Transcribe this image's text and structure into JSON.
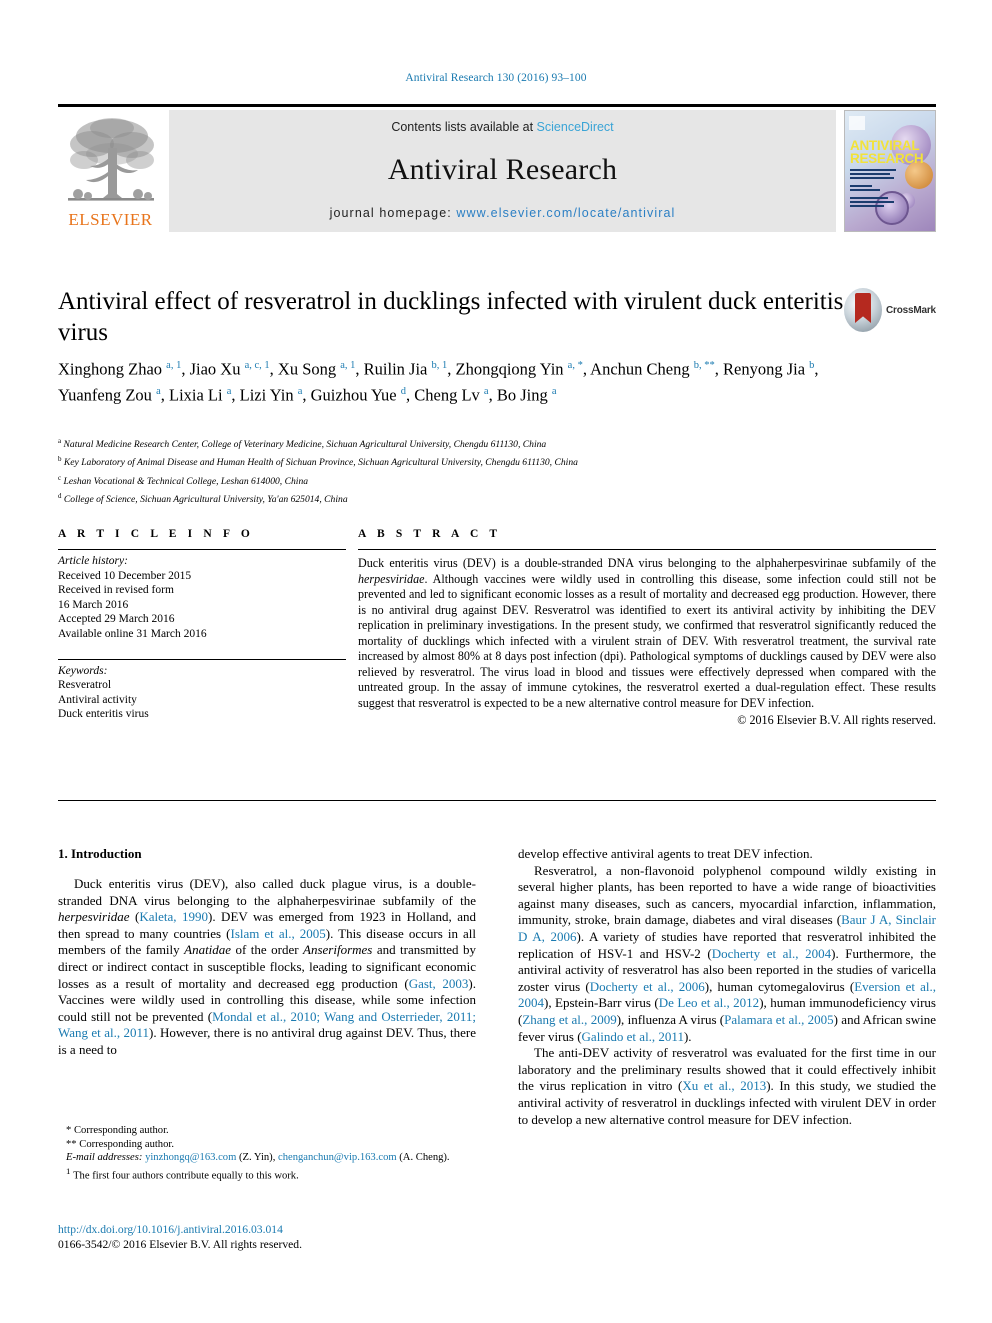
{
  "running_head": "Antiviral Research 130 (2016) 93–100",
  "masthead": {
    "publisher": "ELSEVIER",
    "contents_prefix": "Contents lists available at ",
    "contents_link": "ScienceDirect",
    "journal_name": "Antiviral Research",
    "homepage_prefix": "journal homepage: ",
    "homepage_url": "www.elsevier.com/locate/antiviral",
    "cover_title_line1": "ANTIVIRAL",
    "cover_title_line2": "RESEARCH"
  },
  "article": {
    "title": "Antiviral effect of resveratrol in ducklings infected with virulent duck enteritis virus",
    "crossmark_label": "CrossMark",
    "authors": [
      {
        "name": "Xinghong Zhao",
        "sup": "a, 1",
        "sep": ", "
      },
      {
        "name": "Jiao Xu",
        "sup": "a, c, 1",
        "sep": ", "
      },
      {
        "name": "Xu Song",
        "sup": "a, 1",
        "sep": ", "
      },
      {
        "name": "Ruilin Jia",
        "sup": "b, 1",
        "sep": ", "
      },
      {
        "name": "Zhongqiong Yin",
        "sup": "a, *",
        "sep": ", "
      },
      {
        "name": "Anchun Cheng",
        "sup": "b, **",
        "sep": ", "
      },
      {
        "name": "Renyong Jia",
        "sup": "b",
        "sep": ", "
      },
      {
        "name": "Yuanfeng Zou",
        "sup": "a",
        "sep": ", "
      },
      {
        "name": "Lixia Li",
        "sup": "a",
        "sep": ", "
      },
      {
        "name": "Lizi Yin",
        "sup": "a",
        "sep": ", "
      },
      {
        "name": "Guizhou Yue",
        "sup": "d",
        "sep": ", "
      },
      {
        "name": "Cheng Lv",
        "sup": "a",
        "sep": ", "
      },
      {
        "name": "Bo Jing",
        "sup": "a",
        "sep": ""
      }
    ],
    "affiliations": [
      {
        "mark": "a",
        "text": "Natural Medicine Research Center, College of Veterinary Medicine, Sichuan Agricultural University, Chengdu 611130, China"
      },
      {
        "mark": "b",
        "text": "Key Laboratory of Animal Disease and Human Health of Sichuan Province, Sichuan Agricultural University, Chengdu 611130, China"
      },
      {
        "mark": "c",
        "text": "Leshan Vocational & Technical College, Leshan 614000, China"
      },
      {
        "mark": "d",
        "text": "College of Science, Sichuan Agricultural University, Ya'an 625014, China"
      }
    ]
  },
  "article_info": {
    "heading": "A R T I C L E   I N F O",
    "history_label": "Article history:",
    "history": [
      "Received 10 December 2015",
      "Received in revised form",
      "16 March 2016",
      "Accepted 29 March 2016",
      "Available online 31 March 2016"
    ],
    "keywords_label": "Keywords:",
    "keywords": [
      "Resveratrol",
      "Antiviral activity",
      "Duck enteritis virus"
    ]
  },
  "abstract": {
    "heading": "A B S T R A C T",
    "p1_a": "Duck enteritis virus (DEV) is a double-stranded DNA virus belonging to the alphaherpesvirinae subfamily of the ",
    "p1_i1": "herpesviridae",
    "p1_b": ". Although vaccines were wildly used in controlling this disease, some infection could still not be prevented and led to significant economic losses as a result of mortality and decreased egg production. However, there is no antiviral drug against DEV. Resveratrol was identified to exert its antiviral activity by inhibiting the DEV replication in preliminary investigations. In the present study, we confirmed that resveratrol significantly reduced the mortality of ducklings which infected with a virulent strain of DEV. With resveratrol treatment, the survival rate increased by almost 80% at 8 days post infection (dpi). Pathological symptoms of ducklings caused by DEV were also relieved by resveratrol. The virus load in blood and tissues were effectively depressed when compared with the untreated group. In the assay of immune cytokines, the resveratrol exerted a dual-regulation effect. These results suggest that resveratrol is expected to be a new alternative control measure for DEV infection.",
    "copyright": "© 2016 Elsevier B.V. All rights reserved."
  },
  "introduction": {
    "heading": "1. Introduction",
    "left_p1": {
      "s1": "Duck enteritis virus (DEV), also called duck plague virus, is a double-stranded DNA virus belonging to the alphaherpesvirinae subfamily of the ",
      "i1": "herpesviridae",
      "s2": " (",
      "r1": "Kaleta, 1990",
      "s3": "). DEV was emerged from 1923 in Holland, and then spread to many countries (",
      "r2": "Islam et al., 2005",
      "s4": "). This disease occurs in all members of the family ",
      "i2": "Anatidae",
      "s5": " of the order ",
      "i3": "Anseriformes",
      "s6": " and transmitted by direct or indirect contact in susceptible flocks, leading to significant economic losses as a result of mortality and decreased egg production (",
      "r3": "Gast, 2003",
      "s7": "). Vaccines were wildly used in controlling this disease, while some infection could still not be prevented (",
      "r4": "Mondal et al., 2010; Wang and Osterrieder, 2011; Wang et al., 2011",
      "s8": "). However, there is no antiviral drug against DEV. Thus, there is a need to"
    },
    "right_p0": "develop effective antiviral agents to treat DEV infection.",
    "right_p1": {
      "s1": "Resveratrol, a non-flavonoid polyphenol compound wildly existing in several higher plants, has been reported to have a wide range of bioactivities against many diseases, such as cancers, myocardial infarction, inflammation, immunity, stroke, brain damage, diabetes and viral diseases (",
      "r1": "Baur J A, Sinclair D A, 2006",
      "s2": "). A variety of studies have reported that resveratrol inhibited the replication of HSV-1 and HSV-2 (",
      "r2": "Docherty et al., 2004",
      "s3": "). Furthermore, the antiviral activity of resveratrol has also been reported in the studies of varicella zoster virus (",
      "r3": "Docherty et al., 2006",
      "s4": "), human cytomegalovirus (",
      "r4": "Eversion et al., 2004",
      "s5": "), Epstein-Barr virus (",
      "r5": "De Leo et al., 2012",
      "s6": "), human immunodeficiency virus (",
      "r6": "Zhang et al., 2009",
      "s7": "), influenza A virus (",
      "r7": "Palamara et al., 2005",
      "s8": ") and African swine fever virus (",
      "r8": "Galindo et al., 2011",
      "s9": ")."
    },
    "right_p2": {
      "s1": "The anti-DEV activity of resveratrol was evaluated for the first time in our laboratory and the preliminary results showed that it could effectively inhibit the virus replication in vitro (",
      "r1": "Xu et al., 2013",
      "s2": "). In this study, we studied the antiviral activity of resveratrol in ducklings infected with virulent DEV in order to develop a new alternative control measure for DEV infection."
    }
  },
  "footnotes": {
    "corr1": "Corresponding author.",
    "corr2": "Corresponding author.",
    "email_label": "E-mail addresses:",
    "email1": "yinzhongq@163.com",
    "email1_name": " (Z. Yin), ",
    "email2": "chenganchun@vip.163.com",
    "email2_name": " (A. Cheng).",
    "note1_mark": "1",
    "note1": "The first four authors contribute equally to this work."
  },
  "doi_block": {
    "doi": "http://dx.doi.org/10.1016/j.antiviral.2016.03.014",
    "issn_line": "0166-3542/© 2016 Elsevier B.V. All rights reserved."
  }
}
